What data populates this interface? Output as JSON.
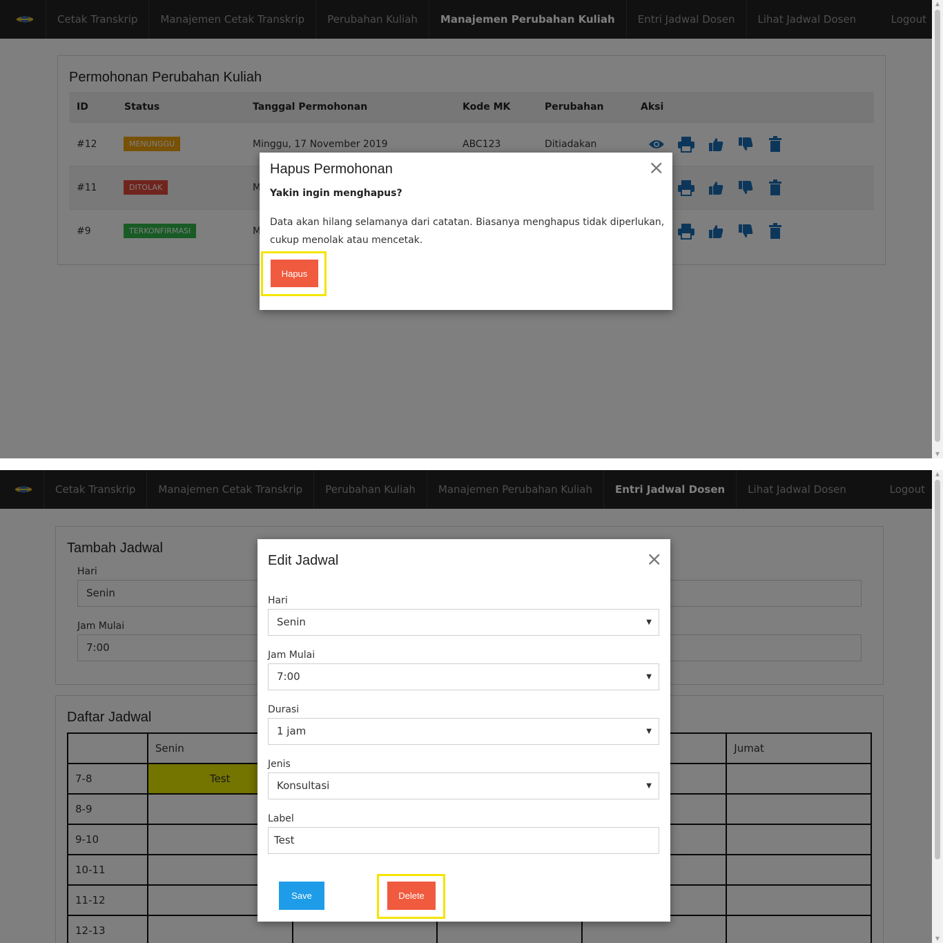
{
  "nav": {
    "items": [
      "Cetak Transkrip",
      "Manajemen Cetak Transkrip",
      "Perubahan Kuliah",
      "Manajemen Perubahan Kuliah",
      "Entri Jadwal Dosen",
      "Lihat Jadwal Dosen"
    ],
    "logout": "Logout"
  },
  "shot1": {
    "active_nav": "Manajemen Perubahan Kuliah",
    "panel_title": "Permohonan Perubahan Kuliah",
    "columns": [
      "ID",
      "Status",
      "Tanggal Permohonan",
      "Kode MK",
      "Perubahan",
      "Aksi"
    ],
    "rows": [
      {
        "id": "#12",
        "status": "MENUNGGU",
        "date": "Minggu, 17 November 2019",
        "code": "ABC123",
        "change": "Ditiadakan"
      },
      {
        "id": "#11",
        "status": "DITOLAK",
        "date": "M",
        "code": "",
        "change": ""
      },
      {
        "id": "#9",
        "status": "TERKONFIRMASI",
        "date": "M",
        "code": "",
        "change": ""
      }
    ],
    "action_icons": [
      "eye-icon",
      "print-icon",
      "thumbs-up-icon",
      "thumbs-down-icon",
      "trash-icon"
    ],
    "modal": {
      "title": "Hapus Permohonan",
      "question": "Yakin ingin menghapus?",
      "body_line1": "Data akan hilang selamanya dari catatan. Biasanya menghapus tidak diperlukan,",
      "body_line2": "cukup menolak atau mencetak.",
      "button": "Hapus",
      "close": "×"
    }
  },
  "shot2": {
    "active_nav": "Entri Jadwal Dosen",
    "form_title": "Tambah Jadwal",
    "form": {
      "hari_label": "Hari",
      "hari_value": "Senin",
      "jam_label": "Jam Mulai",
      "jam_value": "7:00"
    },
    "schedule_title": "Daftar Jadwal",
    "schedule": {
      "days": [
        "Senin",
        "Jumat"
      ],
      "slots": [
        "7-8",
        "8-9",
        "9-10",
        "10-11",
        "11-12",
        "12-13"
      ],
      "entry": "Test"
    },
    "modal": {
      "title": "Edit Jadwal",
      "close": "×",
      "hari_label": "Hari",
      "hari_value": "Senin",
      "jam_label": "Jam Mulai",
      "jam_value": "7:00",
      "durasi_label": "Durasi",
      "durasi_value": "1 jam",
      "jenis_label": "Jenis",
      "jenis_value": "Konsultasi",
      "label_label": "Label",
      "label_value": "Test",
      "save": "Save",
      "delete": "Delete"
    }
  },
  "colors": {
    "navbar": "#222222",
    "menunggu": "#f0a30a",
    "ditolak": "#e0483a",
    "terkonfirmasi": "#31b64a",
    "icon_blue": "#1a6fb5",
    "danger": "#f05a3e",
    "primary": "#1e9ce8",
    "highlight": "#f5e400",
    "schedule_entry": "#e8e800"
  }
}
